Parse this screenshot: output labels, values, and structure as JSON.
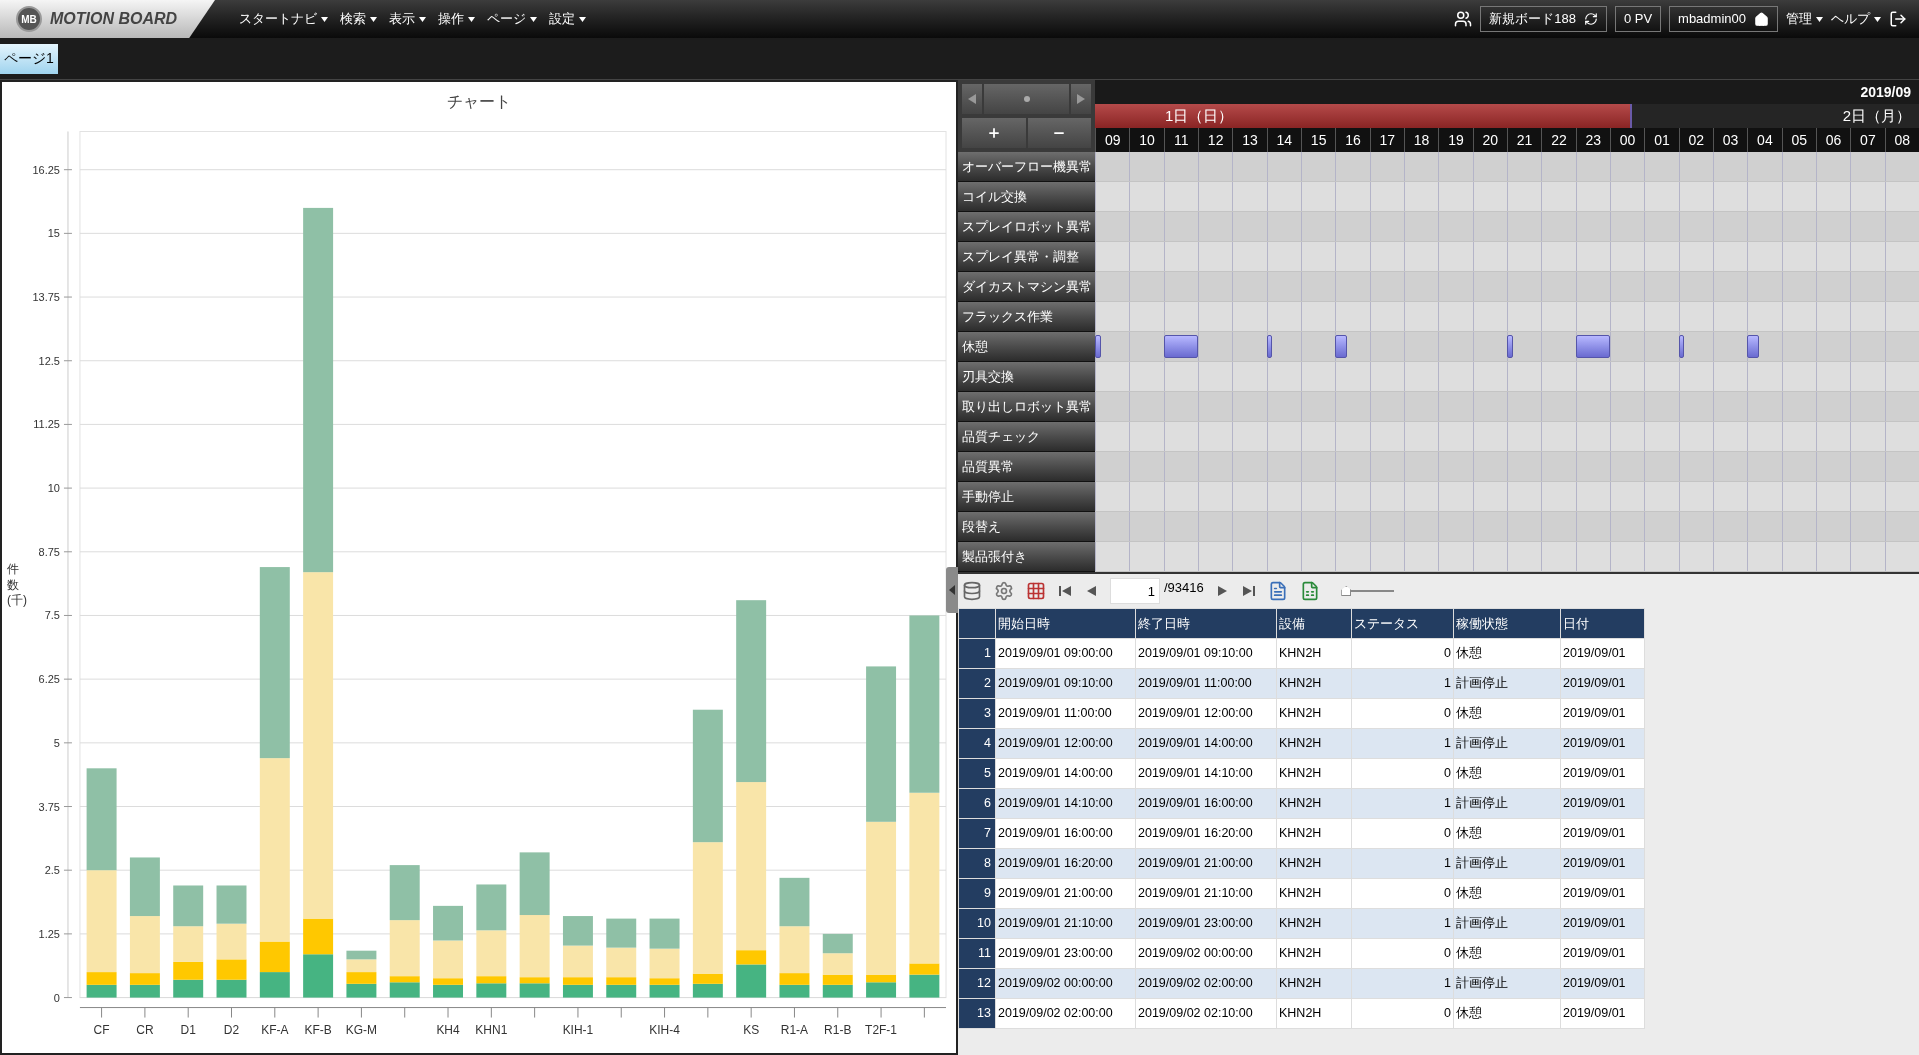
{
  "header": {
    "logo_badge": "MB",
    "logo": "MOTION BOARD",
    "menus": [
      {
        "label": "スタートナビ"
      },
      {
        "label": "検索"
      },
      {
        "label": "表示"
      },
      {
        "label": "操作"
      },
      {
        "label": "ページ"
      },
      {
        "label": "設定"
      }
    ],
    "board": "新規ボード188",
    "pv": "0 PV",
    "user": "mbadmin00",
    "right_menus": [
      {
        "label": "管理"
      },
      {
        "label": "ヘルプ"
      }
    ]
  },
  "tabs": [
    {
      "label": "ページ1",
      "selected": true
    }
  ],
  "chart": {
    "title": "チャート",
    "chart_data": {
      "type": "bar",
      "stacked": true,
      "ylabel": "件数(千)",
      "grid": true,
      "categories": [
        "CF",
        "CR",
        "D1",
        "D2",
        "KF-A",
        "KF-B",
        "KG-M",
        null,
        "KH4",
        "KHN1",
        null,
        "KIH-1",
        null,
        "KIH-4",
        null,
        "KS",
        "R1-A",
        "R1-B",
        "T2F-1",
        null
      ],
      "ylim": [
        0,
        17
      ],
      "yticks": [
        {
          "value": 0,
          "label": "0"
        },
        {
          "value": 1.25,
          "label": "1.25"
        },
        {
          "value": 2.5,
          "label": "2.5"
        },
        {
          "value": 3.75,
          "label": "3.75"
        },
        {
          "value": 5,
          "label": "5"
        },
        {
          "value": 6.25,
          "label": "6.25"
        },
        {
          "value": 7.5,
          "label": "7.5"
        },
        {
          "value": 8.75,
          "label": "8.75"
        },
        {
          "value": 10,
          "label": "10"
        },
        {
          "value": 11.25,
          "label": "11.25"
        },
        {
          "value": 12.5,
          "label": "12.5"
        },
        {
          "value": 13.75,
          "label": "13.75"
        },
        {
          "value": 15,
          "label": "15"
        },
        {
          "value": 16.25,
          "label": "16.25"
        }
      ],
      "series": [
        {
          "color": "#46b482",
          "values": [
            0.25,
            0.25,
            0.35,
            0.35,
            0.5,
            0.85,
            0.27,
            0.3,
            0.25,
            0.28,
            0.28,
            0.25,
            0.25,
            0.25,
            0.27,
            0.65,
            0.25,
            0.25,
            0.3,
            0.45
          ]
        },
        {
          "color": "#ffc800",
          "values": [
            0.25,
            0.23,
            0.35,
            0.4,
            0.6,
            0.7,
            0.23,
            0.12,
            0.13,
            0.14,
            0.12,
            0.15,
            0.15,
            0.13,
            0.2,
            0.28,
            0.23,
            0.2,
            0.15,
            0.22
          ]
        },
        {
          "color": "#f9e5a9",
          "values": [
            2.0,
            1.12,
            0.7,
            0.7,
            3.6,
            6.8,
            0.25,
            1.1,
            0.74,
            0.9,
            1.22,
            0.62,
            0.58,
            0.58,
            2.58,
            3.3,
            0.92,
            0.42,
            3.0,
            3.35
          ]
        },
        {
          "color": "#8fc0a6",
          "values": [
            2.0,
            1.15,
            0.8,
            0.75,
            3.75,
            7.15,
            0.17,
            1.08,
            0.68,
            0.9,
            1.23,
            0.58,
            0.57,
            0.59,
            2.6,
            3.57,
            0.95,
            0.38,
            3.05,
            3.48
          ]
        }
      ]
    }
  },
  "gantt": {
    "year": "2019/09",
    "scroll": {
      "level": 0.5
    },
    "days": [
      {
        "label": "1日（日）",
        "selected": true,
        "hours": [
          "09",
          "10",
          "11",
          "12",
          "13",
          "14",
          "15",
          "16",
          "17",
          "18",
          "19",
          "20",
          "21",
          "22",
          "23"
        ]
      },
      {
        "label": "2日（月）",
        "selected": false,
        "hours": [
          "00",
          "01",
          "02",
          "03",
          "04",
          "05",
          "06",
          "07",
          "08"
        ]
      }
    ],
    "rows": [
      {
        "label": "オーバーフロー機異常",
        "kind": "empty"
      },
      {
        "label": "コイル交換",
        "kind": "empty"
      },
      {
        "label": "スプレイロボット異常",
        "kind": "empty"
      },
      {
        "label": "スプレイ異常・調整",
        "kind": "empty"
      },
      {
        "label": "ダイカストマシン異常",
        "kind": "empty"
      },
      {
        "label": "フラックス作業",
        "kind": "empty"
      },
      {
        "label": "休憩",
        "kind": "busy"
      },
      {
        "label": "刃具交換",
        "kind": "empty"
      },
      {
        "label": "取り出しロボット異常",
        "kind": "empty"
      },
      {
        "label": "品質チェック",
        "kind": "empty"
      },
      {
        "label": "品質異常",
        "kind": "empty"
      },
      {
        "label": "手動停止",
        "kind": "empty"
      },
      {
        "label": "段替え",
        "kind": "empty"
      },
      {
        "label": "製品張付き",
        "kind": "empty"
      }
    ]
  },
  "toolbar": {
    "page": "1",
    "total": "/93416",
    "zoom": {
      "level": 0.05
    }
  },
  "table": {
    "columns": [
      {
        "label": "開始日時",
        "kind": "text"
      },
      {
        "label": "終了日時",
        "kind": "text"
      },
      {
        "label": "設備",
        "kind": "text"
      },
      {
        "label": "ステータス",
        "kind": "number"
      },
      {
        "label": "稼働状態",
        "kind": "text"
      },
      {
        "label": "日付",
        "kind": "text"
      }
    ],
    "rows": [
      {
        "no": "1",
        "cells": [
          "2019/09/01 09:00:00",
          "2019/09/01 09:10:00",
          "KHN2H",
          "0",
          "休憩",
          "2019/09/01"
        ]
      },
      {
        "no": "2",
        "cells": [
          "2019/09/01 09:10:00",
          "2019/09/01 11:00:00",
          "KHN2H",
          "1",
          "計画停止",
          "2019/09/01"
        ]
      },
      {
        "no": "3",
        "cells": [
          "2019/09/01 11:00:00",
          "2019/09/01 12:00:00",
          "KHN2H",
          "0",
          "休憩",
          "2019/09/01"
        ]
      },
      {
        "no": "4",
        "cells": [
          "2019/09/01 12:00:00",
          "2019/09/01 14:00:00",
          "KHN2H",
          "1",
          "計画停止",
          "2019/09/01"
        ]
      },
      {
        "no": "5",
        "cells": [
          "2019/09/01 14:00:00",
          "2019/09/01 14:10:00",
          "KHN2H",
          "0",
          "休憩",
          "2019/09/01"
        ]
      },
      {
        "no": "6",
        "cells": [
          "2019/09/01 14:10:00",
          "2019/09/01 16:00:00",
          "KHN2H",
          "1",
          "計画停止",
          "2019/09/01"
        ]
      },
      {
        "no": "7",
        "cells": [
          "2019/09/01 16:00:00",
          "2019/09/01 16:20:00",
          "KHN2H",
          "0",
          "休憩",
          "2019/09/01"
        ]
      },
      {
        "no": "8",
        "cells": [
          "2019/09/01 16:20:00",
          "2019/09/01 21:00:00",
          "KHN2H",
          "1",
          "計画停止",
          "2019/09/01"
        ]
      },
      {
        "no": "9",
        "cells": [
          "2019/09/01 21:00:00",
          "2019/09/01 21:10:00",
          "KHN2H",
          "0",
          "休憩",
          "2019/09/01"
        ]
      },
      {
        "no": "10",
        "cells": [
          "2019/09/01 21:10:00",
          "2019/09/01 23:00:00",
          "KHN2H",
          "1",
          "計画停止",
          "2019/09/01"
        ]
      },
      {
        "no": "11",
        "cells": [
          "2019/09/01 23:00:00",
          "2019/09/02 00:00:00",
          "KHN2H",
          "0",
          "休憩",
          "2019/09/01"
        ]
      },
      {
        "no": "12",
        "cells": [
          "2019/09/02 00:00:00",
          "2019/09/02 02:00:00",
          "KHN2H",
          "1",
          "計画停止",
          "2019/09/01"
        ]
      },
      {
        "no": "13",
        "cells": [
          "2019/09/02 02:00:00",
          "2019/09/02 02:10:00",
          "KHN2H",
          "0",
          "休憩",
          "2019/09/01"
        ]
      }
    ]
  }
}
